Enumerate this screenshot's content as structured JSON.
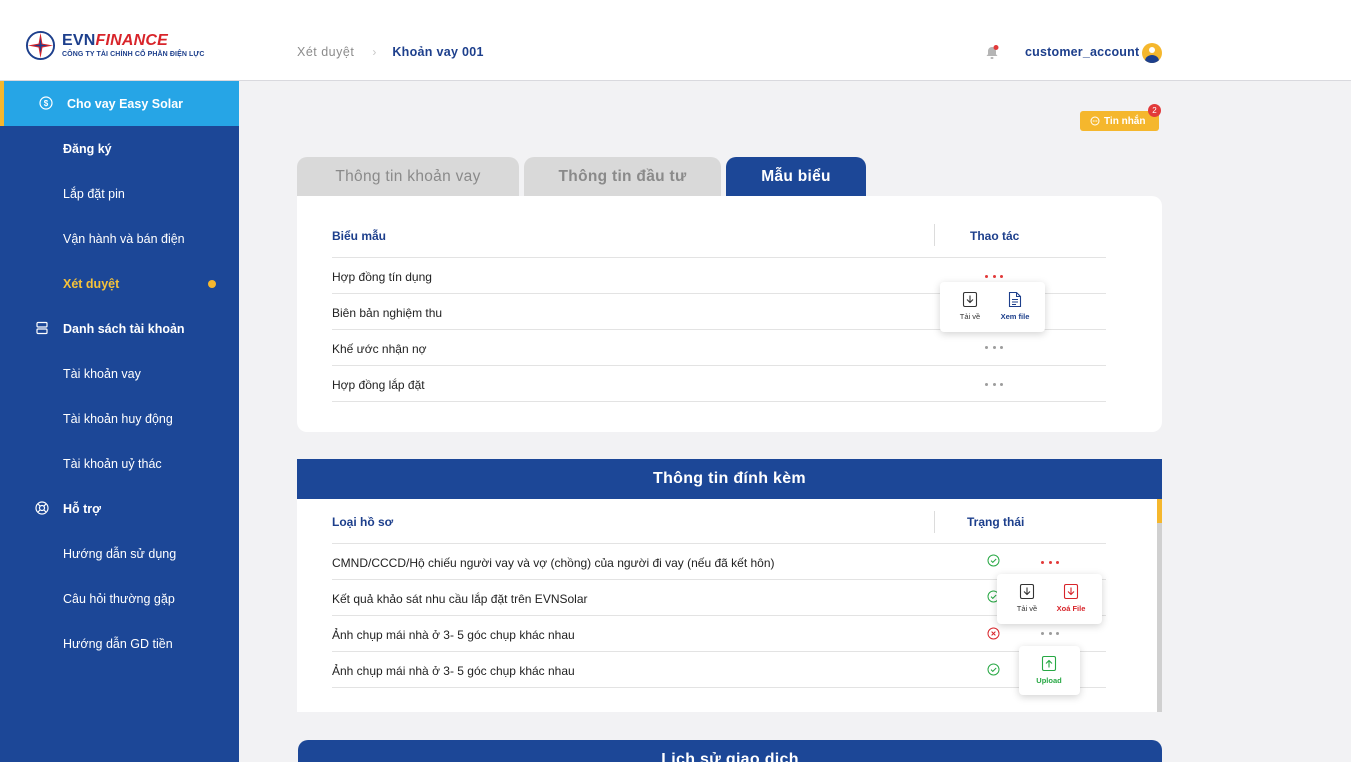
{
  "brand": {
    "name_evn": "EVN",
    "name_finance": "FINANCE",
    "subtitle": "CÔNG TY TÀI CHÍNH CỔ PHẦN ĐIỆN LỰC"
  },
  "breadcrumb": {
    "parent": "Xét duyệt",
    "current": "Khoản vay 001"
  },
  "user": {
    "name": "customer_account"
  },
  "sidebar": {
    "items": [
      {
        "label": "Cho vay Easy Solar"
      },
      {
        "label": "Đăng ký"
      },
      {
        "label": "Lắp đặt pin"
      },
      {
        "label": "Vận hành và bán điện"
      },
      {
        "label": "Xét duyệt"
      },
      {
        "label": "Danh sách tài khoản"
      },
      {
        "label": "Tài khoản vay"
      },
      {
        "label": "Tài khoản huy động"
      },
      {
        "label": "Tài khoản uỷ thác"
      },
      {
        "label": "Hỗ trợ"
      },
      {
        "label": "Hướng dẫn sử dụng"
      },
      {
        "label": "Câu hỏi thường gặp"
      },
      {
        "label": "Hướng dẫn GD tiền"
      }
    ]
  },
  "messages": {
    "label": "Tin nhắn",
    "count": "2"
  },
  "tabs": [
    {
      "label": "Thông tin khoản vay"
    },
    {
      "label": "Thông tin đầu tư"
    },
    {
      "label": "Mẫu biểu"
    }
  ],
  "forms_table": {
    "col_name": "Biểu mẫu",
    "col_action": "Thao tác",
    "rows": [
      {
        "name": "Hợp đồng tín dụng"
      },
      {
        "name": "Biên bản nghiệm thu"
      },
      {
        "name": "Khế ước nhận nợ"
      },
      {
        "name": "Hợp đồng lắp đặt"
      }
    ],
    "popup": {
      "download": "Tải về",
      "view": "Xem file"
    }
  },
  "attachments": {
    "title": "Thông tin đính kèm",
    "col_type": "Loại hồ sơ",
    "col_status": "Trạng thái",
    "rows": [
      {
        "name": "CMND/CCCD/Hộ chiếu người vay và vợ (chồng) của người đi vay (nếu đã kết hôn)",
        "status": "ok"
      },
      {
        "name": "Kết quả khảo sát nhu cầu lắp đặt trên EVNSolar",
        "status": "ok"
      },
      {
        "name": "Ảnh chụp mái nhà ở 3- 5 góc chụp khác nhau",
        "status": "error"
      },
      {
        "name": "Ảnh chụp mái nhà ở 3- 5 góc chụp khác nhau",
        "status": "ok"
      }
    ],
    "popup": {
      "download": "Tải về",
      "delete": "Xoá File"
    },
    "upload_popup": {
      "upload": "Upload"
    }
  },
  "history": {
    "title": "Lịch sử giao dịch"
  },
  "colors": {
    "primary": "#1c4797",
    "accent": "#f5b72d",
    "active": "#26a5e6",
    "danger": "#e23a3a",
    "success": "#27a844"
  }
}
